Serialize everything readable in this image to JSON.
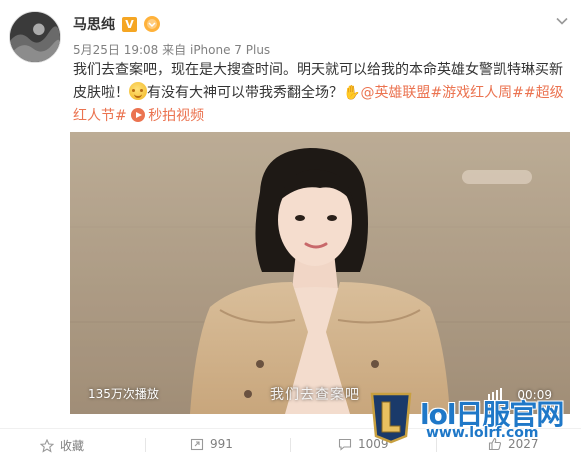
{
  "user": {
    "name": "马思纯",
    "badge_v": "V",
    "avatar_icon": "avatar-photo"
  },
  "meta": {
    "date": "5月25日 19:08",
    "source_prefix": "来自",
    "device": "iPhone 7 Plus"
  },
  "post": {
    "text_part1": "我们去查案吧，现在是大搜查时间。明天就可以给我的本命英雄女警凯特琳买新皮肤啦！",
    "text_part2": "有没有大神可以带我秀翻全场？",
    "mention": "@英雄联盟",
    "hashtag1": "#游戏红人周#",
    "hashtag2": "#超级红人节#",
    "video_link": "秒拍视频"
  },
  "video": {
    "view_count": "135万次播放",
    "subtitle": "我们去查案吧",
    "duration": "00:09"
  },
  "watermark": {
    "title": "lol日服官网",
    "url": "www.lolrf.com"
  },
  "actions": {
    "favorite": "收藏",
    "repost": "991",
    "comment": "1009",
    "like": "2027"
  },
  "colors": {
    "link": "#eb7350",
    "watermark_blue": "#1f78c8"
  }
}
